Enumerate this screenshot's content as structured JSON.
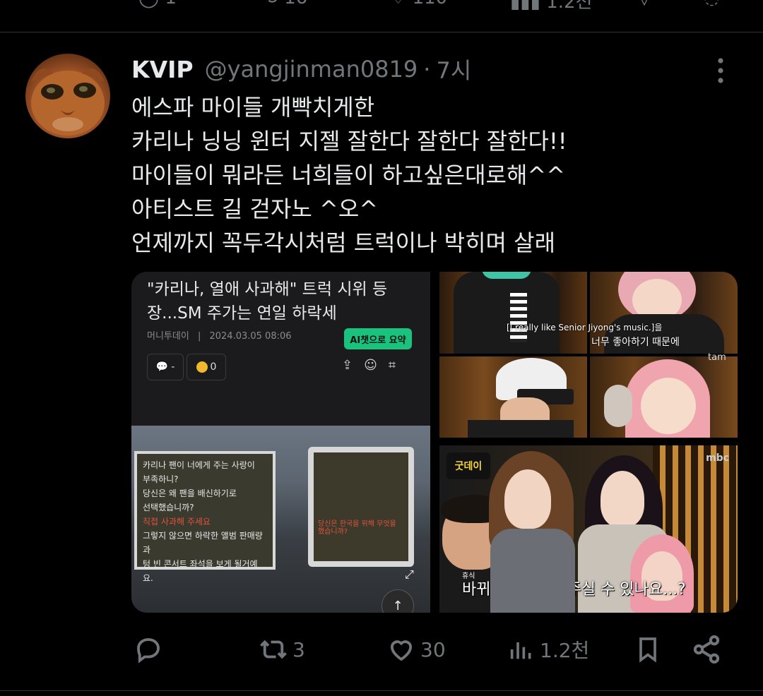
{
  "previous_tweet": {
    "reply_count": "1",
    "retweet_count": "16",
    "like_count": "110",
    "view_count": "1.2천"
  },
  "tweet": {
    "author_name": "KVIP",
    "author_handle": "@yangjinman0819",
    "separator": "·",
    "time": "7시",
    "lines": [
      "에스파 마이들 개빡치게한",
      "카리나 닝닝 윈터 지젤 잘한다 잘한다 잘한다!!",
      "마이들이 뭐라든 너희들이 하고싶은대로해^^",
      "아티스트 길 걷자노 ^오^",
      "언제까지 꼭두각시처럼 트럭이나 박히며 살래"
    ]
  },
  "media": {
    "article": {
      "title": "\"카리나, 열애 사과해\" 트럭 시위 등장...SM 주가는 연일 하락세",
      "source": "머니투데이",
      "date": "2024.03.05 08:06",
      "ai_button": "AI챗으로 요약",
      "comment_pill": "-",
      "reaction_count": "0",
      "sign1_lines": [
        "카리나 팬이 너에게 주는 사랑이",
        "부족하니?",
        "당신은 왜 팬을 배신하기로",
        "선택했습니까?",
        "직접 사과해 주세요",
        "그렇지 않으면 하락한 앨범 판매량과",
        "텅 빈 콘서트 좌석을 보게 될거예요."
      ],
      "sign2_text": "당신은 한국을 위해 무엇을 했습니까?"
    },
    "grid_subtitle_en": "[I really like Senior Jiyong's music.]을",
    "grid_subtitle_ko": "너무 좋아하기 때문에",
    "grid_watermark": "tam",
    "show_logo": "굿데이",
    "show_network": "mbc",
    "show_tag": "휴식",
    "show_subtitle": "바뀌벌레도 잡아주실 수 있나요...?"
  },
  "actions": {
    "reply_count": "",
    "retweet_count": "3",
    "like_count": "30",
    "view_count": "1.2천"
  },
  "colors": {
    "background": "#000000",
    "text": "#e7e9ea",
    "secondary": "#71767b",
    "divider": "#2f3336"
  }
}
